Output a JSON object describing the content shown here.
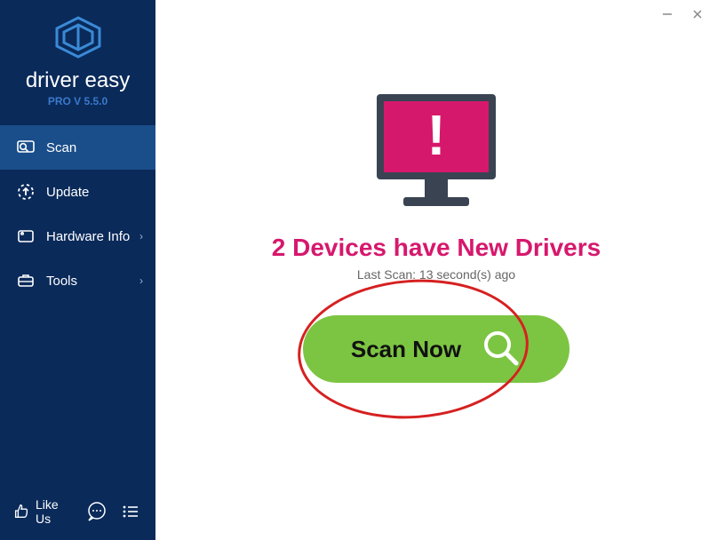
{
  "brand": {
    "name": "driver easy",
    "version_label": "PRO V 5.5.0"
  },
  "sidebar": {
    "items": [
      {
        "label": "Scan"
      },
      {
        "label": "Update"
      },
      {
        "label": "Hardware Info"
      },
      {
        "label": "Tools"
      }
    ],
    "like_us_label": "Like Us"
  },
  "main": {
    "status_text": "2 Devices have New Drivers",
    "last_scan_text": "Last Scan: 13 second(s) ago",
    "scan_button_label": "Scan Now"
  },
  "colors": {
    "sidebar_bg": "#0a2a5a",
    "sidebar_active": "#1a4e8a",
    "status_pink": "#d6186d",
    "scan_green": "#7cc542",
    "highlight_red": "#d62020"
  }
}
